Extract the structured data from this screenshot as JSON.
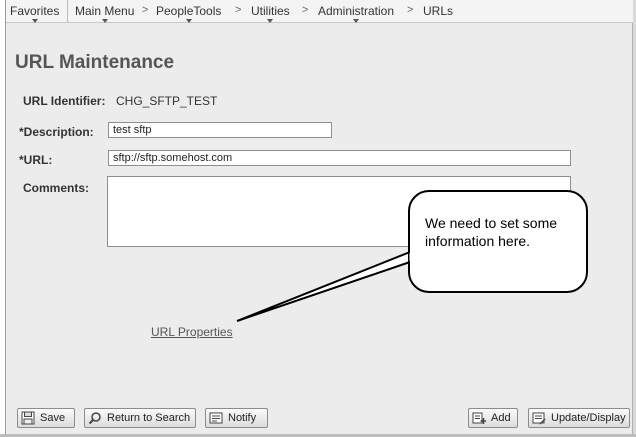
{
  "nav": {
    "items": [
      {
        "label": "Favorites",
        "has_arrow": true
      },
      {
        "label": "Main Menu",
        "has_arrow": true
      },
      {
        "label": "PeopleTools",
        "has_arrow": true
      },
      {
        "label": "Utilities",
        "has_arrow": true
      },
      {
        "label": "Administration",
        "has_arrow": true
      },
      {
        "label": "URLs",
        "has_arrow": false
      }
    ],
    "separator": ">"
  },
  "page": {
    "title": "URL Maintenance"
  },
  "form": {
    "url_identifier_label": "URL Identifier:",
    "url_identifier_value": "CHG_SFTP_TEST",
    "description_label": "*Description:",
    "description_value": "test sftp",
    "url_label": "*URL:",
    "url_value": "sftp://sftp.somehost.com",
    "comments_label": "Comments:",
    "comments_value": "",
    "url_properties_link": "URL Properties"
  },
  "callout": {
    "text": "We need to set some information here."
  },
  "toolbar": {
    "save_label": "Save",
    "return_label": "Return to Search",
    "notify_label": "Notify",
    "add_label": "Add",
    "update_label": "Update/Display"
  },
  "icons": {
    "save": "floppy-disk-icon",
    "return": "magnifier-return-icon",
    "notify": "notify-document-icon",
    "add": "add-list-icon",
    "update": "update-display-icon"
  }
}
